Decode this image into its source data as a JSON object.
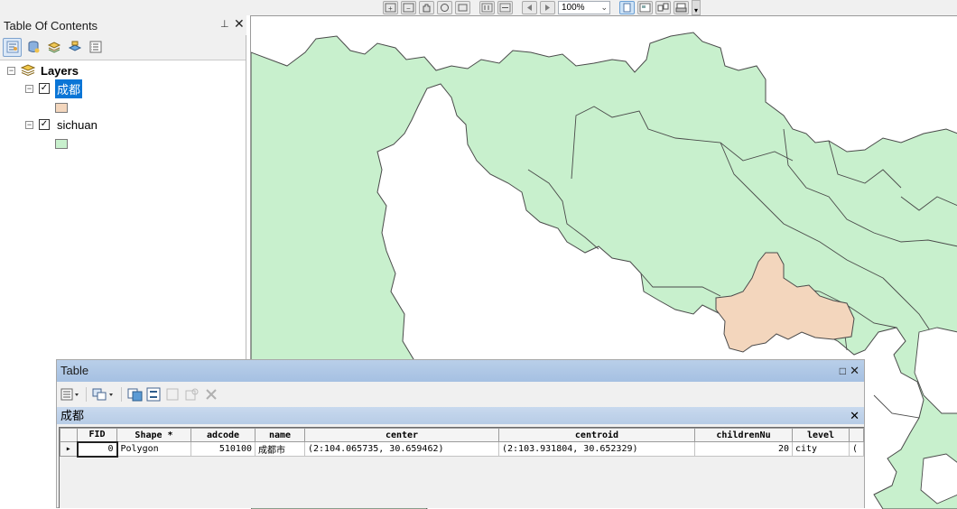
{
  "toolbar": {
    "zoom_value": "100%",
    "icons": [
      "zoom-in-icon",
      "zoom-out-icon",
      "pan-icon",
      "full-extent-icon",
      "fixed-zoom-icon",
      "previous-extent-icon",
      "next-extent-icon",
      "back-icon",
      "forward-icon",
      "page-icon",
      "layout-icon",
      "export-icon",
      "overflow-icon"
    ]
  },
  "toc": {
    "title": "Table Of Contents",
    "pin_glyph": "⊥",
    "close_glyph": "✕",
    "tools": [
      "list-by-drawing-order-icon",
      "list-by-source-icon",
      "list-by-visibility-icon",
      "list-by-selection-icon",
      "options-icon"
    ],
    "root_label": "Layers",
    "layers": [
      {
        "name": "成都",
        "checked": true,
        "expander": "−",
        "swatch_color": "#f3d6bd",
        "selected": true
      },
      {
        "name": "sichuan",
        "checked": true,
        "expander": "−",
        "swatch_color": "#c8f0cd",
        "selected": false
      }
    ]
  },
  "map": {
    "background": "#ffffff",
    "province_fill": "#c8f0cd",
    "highlight_fill": "#f3d6bd",
    "stroke": "#4a4a4a"
  },
  "table_window": {
    "title": "Table",
    "max_glyph": "□",
    "close_glyph": "✕",
    "tab_label": "成都",
    "tab_close_glyph": "✕",
    "toolbar_icons": [
      "table-options-icon",
      "related-tables-icon",
      "select-by-attributes-icon",
      "switch-selection-icon",
      "clear-selection-icon",
      "zoom-to-selected-icon",
      "delete-selected-icon"
    ],
    "columns": [
      "FID",
      "Shape *",
      "adcode",
      "name",
      "center",
      "centroid",
      "childrenNu",
      "level"
    ],
    "rows": [
      {
        "FID": "0",
        "Shape": "Polygon",
        "adcode": "510100",
        "name": "成都市",
        "center": "(2:104.065735, 30.659462)",
        "centroid": "(2:103.931804, 30.652329)",
        "childrenNu": "20",
        "level": "city",
        "overflow": "("
      }
    ]
  }
}
